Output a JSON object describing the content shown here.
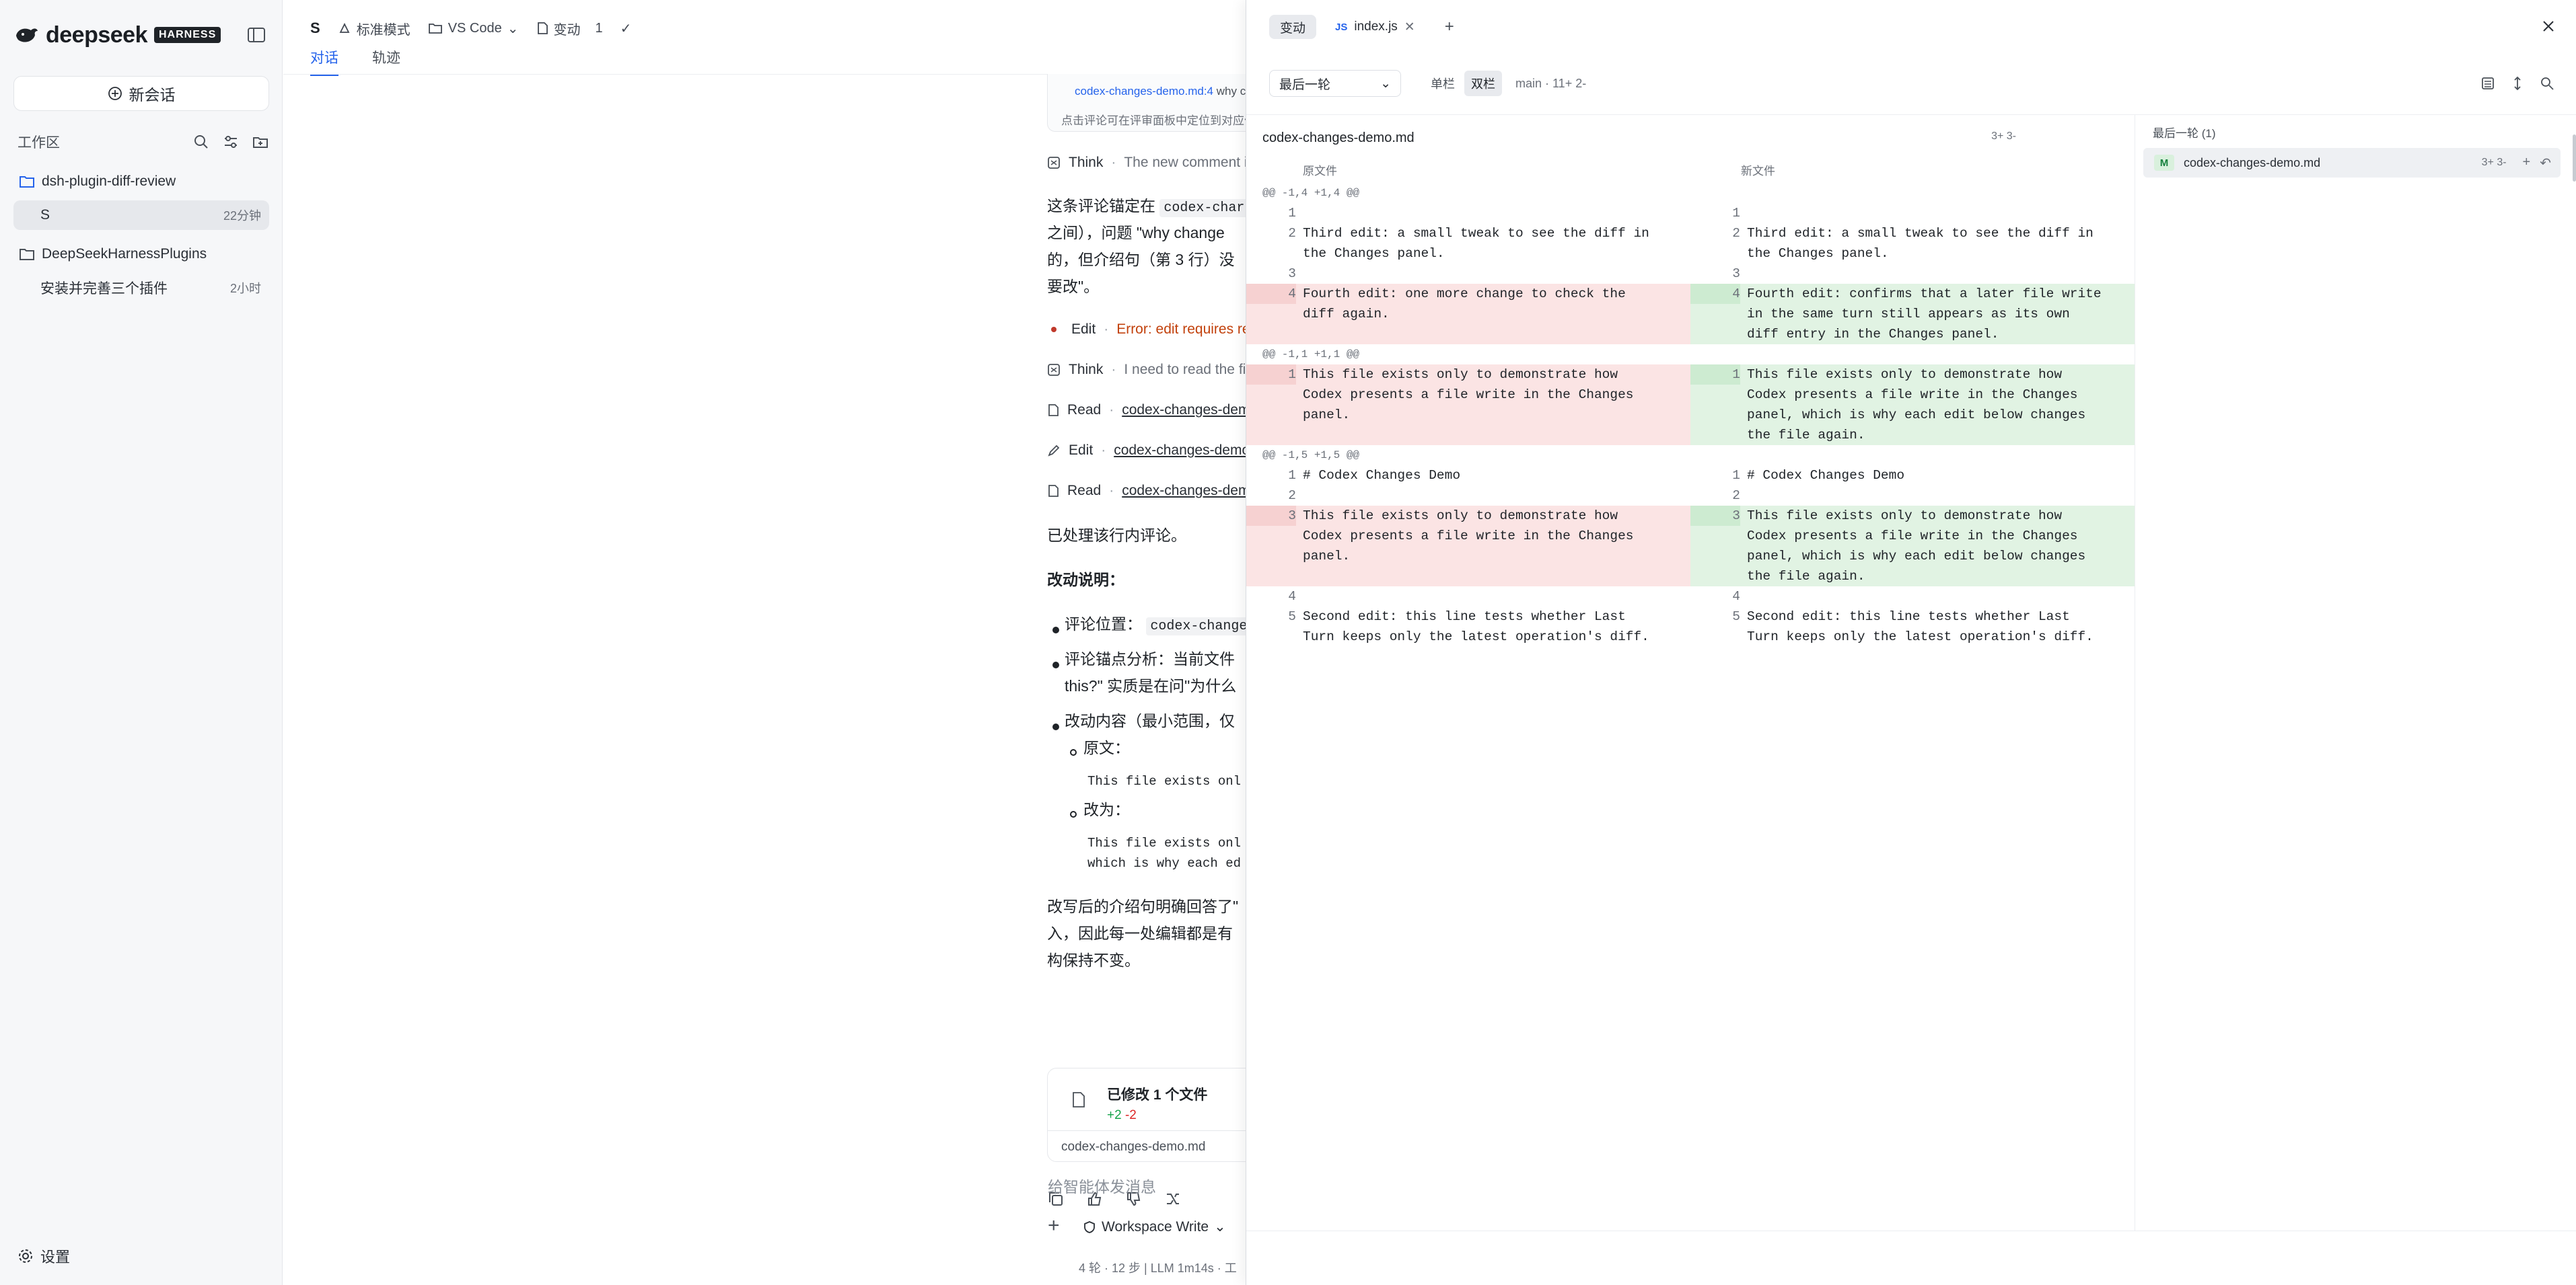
{
  "sidebar": {
    "brand": "deepseek",
    "badge": "HARNESS",
    "new_chat": "新会话",
    "workspace_title": "工作区",
    "tree": [
      {
        "label": "dsh-plugin-diff-review",
        "meta": "",
        "type": "folder"
      },
      {
        "label": "S",
        "meta": "22分钟",
        "type": "session"
      },
      {
        "label": "DeepSeekHarnessPlugins",
        "meta": "",
        "type": "folder"
      },
      {
        "label": "安装并完善三个插件",
        "meta": "2小时",
        "type": "session"
      }
    ],
    "settings": "设置"
  },
  "chat": {
    "title": "S",
    "mode": "标准模式",
    "editor": "VS Code",
    "changes_label": "变动",
    "changes_count": "1",
    "tabs": [
      "对话",
      "轨迹"
    ],
    "ref_file": "codex-changes-demo.md:4",
    "ref_question": "why c",
    "ref_hint": "点击评论可在评审面板中定位到对应位",
    "think1_label": "Think",
    "think1_text": "The new comment i",
    "para1_l1_prefix": "这条评论锚定在",
    "para1_l1_code": "codex-char",
    "para1_l2": "之间），问题 \"why change",
    "para1_l3": "的，但介绍句（第 3 行）没",
    "para1_l4": "要改\"。",
    "edit1_label": "Edit",
    "edit1_text": "Error: edit requires rea",
    "think2_label": "Think",
    "think2_text": "I need to read the fi",
    "read1_label": "Read",
    "read1_file": "codex-changes-demo",
    "edit2_label": "Edit",
    "edit2_file": "codex-changes-demo",
    "read2_label": "Read",
    "read2_file": "codex-changes-dem",
    "handled": "已处理该行内评论。",
    "explain_title": "改动说明：",
    "b1_prefix": "评论位置：",
    "b1_code": "codex-change",
    "b2_l1": "评论锚点分析：当前文件",
    "b2_l2": "this?\" 实质是在问\"为什么",
    "b3": "改动内容（最小范围，仅",
    "orig_label": "原文：",
    "orig_code": "This file exists onl",
    "new_label": "改为：",
    "new_code_l1": "This file exists onl",
    "new_code_l2": "which is why each ed",
    "summary_l1": "改写后的介绍句明确回答了\"",
    "summary_l2": "入，因此每一处编辑都是有",
    "summary_l3": "构保持不变。",
    "changed_title": "已修改 1 个文件",
    "changed_plus": "+2",
    "changed_minus": "-2",
    "changed_file": "codex-changes-demo.md",
    "composer_placeholder": "给智能体发消息",
    "composer_mode": "Workspace Write",
    "status": "4 轮 · 12 步  |  LLM 1m14s · 工"
  },
  "diff": {
    "tabs": [
      {
        "label": "变动",
        "active": true
      },
      {
        "label": "index.js",
        "active": false
      }
    ],
    "turn_select": "最后一轮",
    "view_single": "单栏",
    "view_split": "双栏",
    "branch": "main · 11+ 2-",
    "file_name": "codex-changes-demo.md",
    "file_stat": "3+ 3-",
    "col_old": "原文件",
    "col_new": "新文件",
    "hunks": [
      {
        "header": "@@ -1,4 +1,4 @@",
        "rows": [
          {
            "kind": "ctx",
            "ln_old": "1",
            "old": "",
            "ln_new": "1",
            "new": ""
          },
          {
            "kind": "ctx",
            "ln_old": "2",
            "old": "Third edit: a small tweak to see the diff in the Changes panel.",
            "ln_new": "2",
            "new": "Third edit: a small tweak to see the diff in the Changes panel."
          },
          {
            "kind": "ctx",
            "ln_old": "3",
            "old": "",
            "ln_new": "3",
            "new": ""
          },
          {
            "kind": "chg",
            "ln_old": "4",
            "old": "Fourth edit: one more change to check the diff again.",
            "ln_new": "4",
            "new": "Fourth edit: confirms that a later file write in the same turn still appears as its own diff entry in the Changes panel."
          }
        ]
      },
      {
        "header": "@@ -1,1 +1,1 @@",
        "rows": [
          {
            "kind": "chg",
            "ln_old": "1",
            "old": "This file exists only to demonstrate how Codex presents a file write in the Changes panel.",
            "ln_new": "1",
            "new": "This file exists only to demonstrate how Codex presents a file write in the Changes panel, which is why each edit below changes the file again."
          }
        ]
      },
      {
        "header": "@@ -1,5 +1,5 @@",
        "rows": [
          {
            "kind": "ctx",
            "ln_old": "1",
            "old": "# Codex Changes Demo",
            "ln_new": "1",
            "new": "# Codex Changes Demo"
          },
          {
            "kind": "ctx",
            "ln_old": "2",
            "old": "",
            "ln_new": "2",
            "new": ""
          },
          {
            "kind": "chg",
            "ln_old": "3",
            "old": "This file exists only to demonstrate how Codex presents a file write in the Changes panel.",
            "ln_new": "3",
            "new": "This file exists only to demonstrate how Codex presents a file write in the Changes panel, which is why each edit below changes the file again."
          },
          {
            "kind": "ctx",
            "ln_old": "4",
            "old": "",
            "ln_new": "4",
            "new": ""
          },
          {
            "kind": "ctx",
            "ln_old": "5",
            "old": "Second edit: this line tests whether Last Turn keeps only the latest operation's diff.",
            "ln_new": "5",
            "new": "Second edit: this line tests whether Last Turn keeps only the latest operation's diff."
          }
        ]
      }
    ],
    "side_title": "最后一轮 (1)",
    "side_file": {
      "status": "M",
      "name": "codex-changes-demo.md",
      "stat": "3+ 3-"
    }
  },
  "colors": {
    "accent": "#2563eb",
    "added_bg": "#e1f3e3",
    "removed_bg": "#fbe4e4"
  }
}
